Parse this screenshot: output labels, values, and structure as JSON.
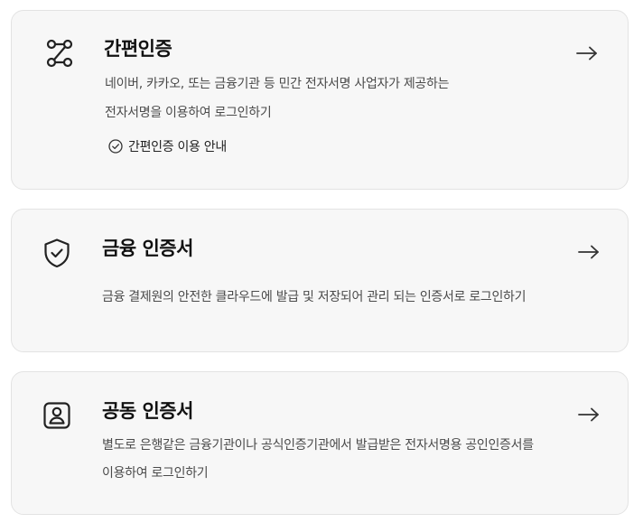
{
  "cards": [
    {
      "id": "simple-auth",
      "title": "간편인증",
      "icon": "route-icon",
      "description_lines": [
        "네이버, 카카오, 또는 금융기관 등 민간 전자서명 사업자가 제공하는",
        "전자서명을 이용하여 로그인하기"
      ],
      "guide_link": "간편인증 이용 안내",
      "arrow": "arrow-right-icon"
    },
    {
      "id": "financial-cert",
      "title": "금융 인증서",
      "icon": "shield-check-icon",
      "description_lines": [
        "금융 결제원의 안전한 클라우드에 발급 및 저장되어 관리 되는 인증서로 로그인하기"
      ],
      "arrow": "arrow-right-icon"
    },
    {
      "id": "joint-cert",
      "title": "공동 인증서",
      "icon": "user-badge-icon",
      "description_lines": [
        "별도로 은행같은 금융기관이나 공식인증기관에서 발급받은 전자서명용 공인인증서를",
        "이용하여 로그인하기"
      ],
      "arrow": "arrow-right-icon"
    }
  ],
  "colors": {
    "card_background": "#f7f7f7",
    "card_border": "#e3e3e3",
    "title": "#111111",
    "description": "#4a4a4a"
  }
}
